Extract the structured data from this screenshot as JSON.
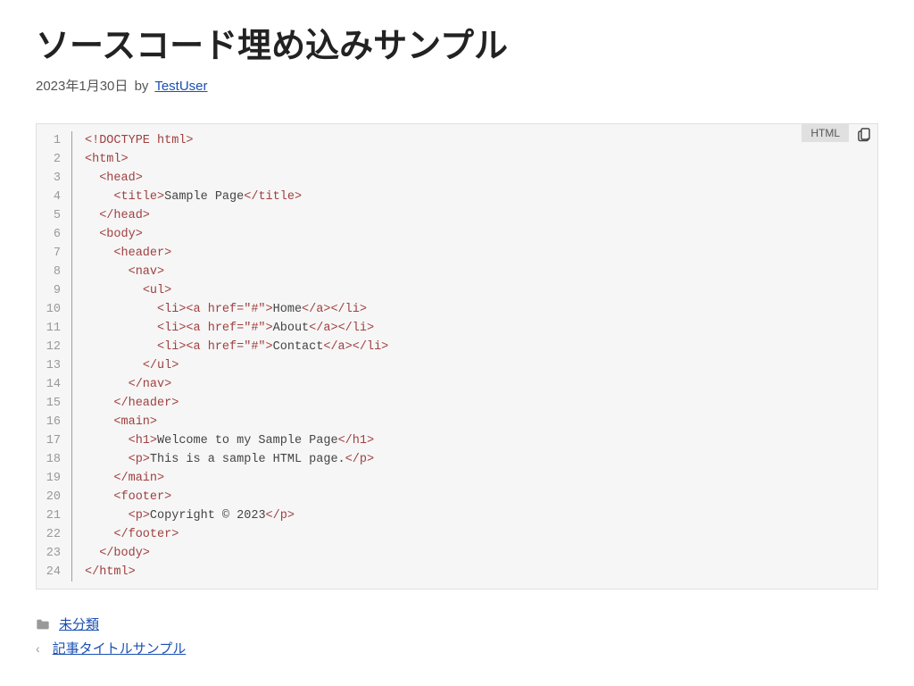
{
  "header": {
    "title": "ソースコード埋め込みサンプル",
    "date": "2023年1月30日",
    "by": "by",
    "author": "TestUser"
  },
  "code": {
    "lang": "HTML",
    "lines": [
      {
        "n": "1",
        "p": "",
        "t": "<!DOCTYPE html>"
      },
      {
        "n": "2",
        "p": "",
        "t": "<html>"
      },
      {
        "n": "3",
        "p": "  ",
        "t": "<head>"
      },
      {
        "n": "4",
        "p": "    ",
        "t": "<title>Sample Page</title>"
      },
      {
        "n": "5",
        "p": "  ",
        "t": "</head>"
      },
      {
        "n": "6",
        "p": "  ",
        "t": "<body>"
      },
      {
        "n": "7",
        "p": "    ",
        "t": "<header>"
      },
      {
        "n": "8",
        "p": "      ",
        "t": "<nav>"
      },
      {
        "n": "9",
        "p": "        ",
        "t": "<ul>"
      },
      {
        "n": "10",
        "p": "          ",
        "t": "<li><a href=\"#\">Home</a></li>"
      },
      {
        "n": "11",
        "p": "          ",
        "t": "<li><a href=\"#\">About</a></li>"
      },
      {
        "n": "12",
        "p": "          ",
        "t": "<li><a href=\"#\">Contact</a></li>"
      },
      {
        "n": "13",
        "p": "        ",
        "t": "</ul>"
      },
      {
        "n": "14",
        "p": "      ",
        "t": "</nav>"
      },
      {
        "n": "15",
        "p": "    ",
        "t": "</header>"
      },
      {
        "n": "16",
        "p": "    ",
        "t": "<main>"
      },
      {
        "n": "17",
        "p": "      ",
        "t": "<h1>Welcome to my Sample Page</h1>"
      },
      {
        "n": "18",
        "p": "      ",
        "t": "<p>This is a sample HTML page.</p>"
      },
      {
        "n": "19",
        "p": "    ",
        "t": "</main>"
      },
      {
        "n": "20",
        "p": "    ",
        "t": "<footer>"
      },
      {
        "n": "21",
        "p": "      ",
        "t": "<p>Copyright © 2023</p>"
      },
      {
        "n": "22",
        "p": "    ",
        "t": "</footer>"
      },
      {
        "n": "23",
        "p": "  ",
        "t": "</body>"
      },
      {
        "n": "24",
        "p": "",
        "t": "</html>"
      }
    ]
  },
  "footer": {
    "category": "未分類",
    "prev_post": "記事タイトルサンプル"
  }
}
